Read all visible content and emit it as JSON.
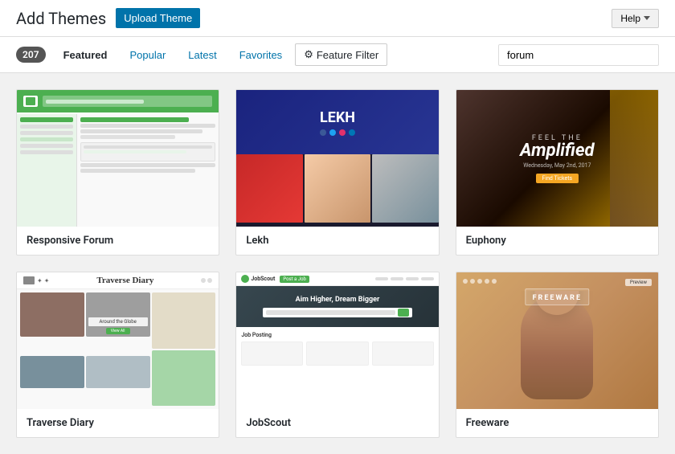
{
  "header": {
    "title": "Add Themes",
    "upload_btn": "Upload Theme",
    "help_btn": "Help"
  },
  "nav": {
    "count": "207",
    "tabs": [
      {
        "label": "Featured",
        "active": true
      },
      {
        "label": "Popular",
        "active": false
      },
      {
        "label": "Latest",
        "active": false
      },
      {
        "label": "Favorites",
        "active": false
      }
    ],
    "feature_filter": "Feature Filter",
    "search_placeholder": "forum",
    "search_value": "forum"
  },
  "themes": [
    {
      "id": 1,
      "name": "Responsive Forum",
      "type": "forum"
    },
    {
      "id": 2,
      "name": "Lekh",
      "type": "lekh"
    },
    {
      "id": 3,
      "name": "Euphony",
      "type": "euphony"
    },
    {
      "id": 4,
      "name": "Traverse Diary",
      "type": "traverse"
    },
    {
      "id": 5,
      "name": "JobScout",
      "type": "jobscout"
    },
    {
      "id": 6,
      "name": "Freeware",
      "type": "freeware"
    }
  ]
}
